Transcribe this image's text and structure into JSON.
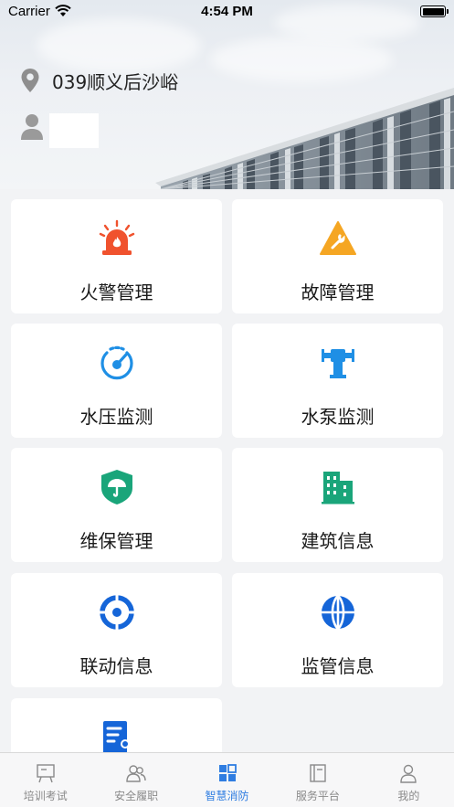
{
  "status_bar": {
    "carrier": "Carrier",
    "time": "4:54 PM"
  },
  "header": {
    "location": "039顺义后沙峪",
    "user_name": ""
  },
  "menu": [
    {
      "label": "火警管理",
      "icon": "fire-alarm-icon",
      "color": "#f0522e"
    },
    {
      "label": "故障管理",
      "icon": "fault-warning-icon",
      "color": "#f5a623"
    },
    {
      "label": "水压监测",
      "icon": "pressure-gauge-icon",
      "color": "#1f8fe5"
    },
    {
      "label": "水泵监测",
      "icon": "water-pump-icon",
      "color": "#1f8fe5"
    },
    {
      "label": "维保管理",
      "icon": "maintenance-shield-icon",
      "color": "#1aa57a"
    },
    {
      "label": "建筑信息",
      "icon": "building-icon",
      "color": "#1aa57a"
    },
    {
      "label": "联动信息",
      "icon": "linkage-target-icon",
      "color": "#1565d8"
    },
    {
      "label": "监管信息",
      "icon": "globe-monitor-icon",
      "color": "#1565d8"
    },
    {
      "label": "",
      "icon": "document-user-icon",
      "color": "#1565d8"
    }
  ],
  "tabbar": {
    "active_color": "#2f7de1",
    "items": [
      {
        "label": "培训考试",
        "icon": "presentation-board-icon"
      },
      {
        "label": "安全履职",
        "icon": "users-icon"
      },
      {
        "label": "智慧消防",
        "icon": "grid-apps-icon",
        "active": true
      },
      {
        "label": "服务平台",
        "icon": "book-icon"
      },
      {
        "label": "我的",
        "icon": "person-icon"
      }
    ]
  }
}
